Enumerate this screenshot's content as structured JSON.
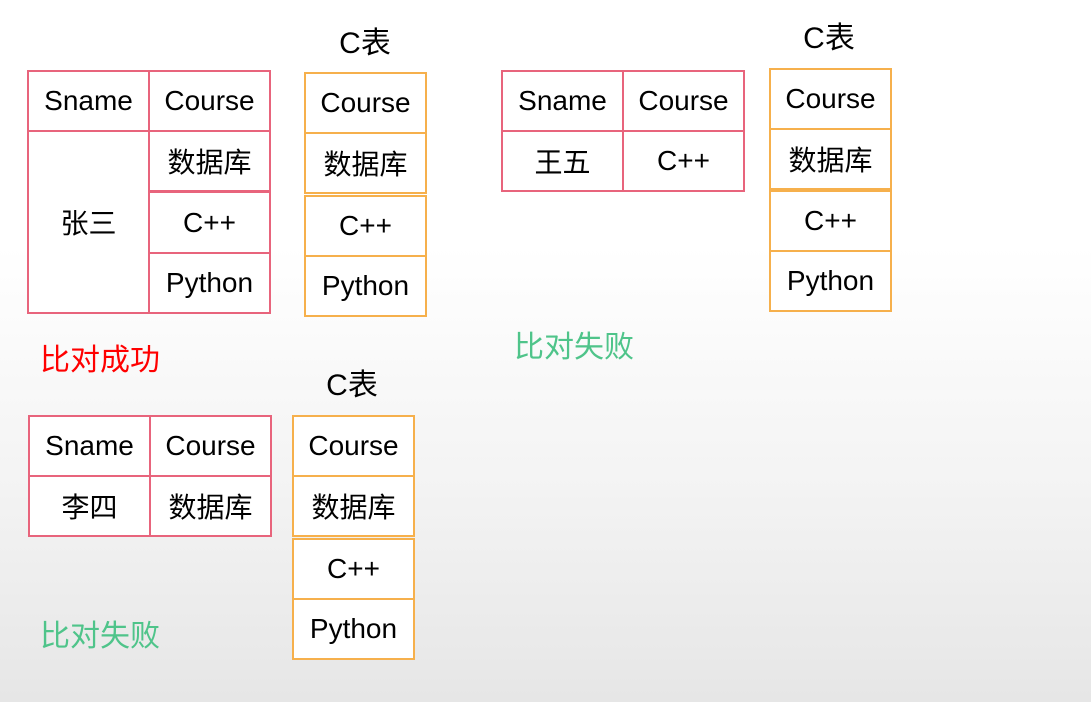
{
  "colors": {
    "student_table_border": "#e8647c",
    "c_table_border": "#f6b04c",
    "success_text": "#ff0000",
    "failure_text": "#4fc48a"
  },
  "groups": [
    {
      "student_table": {
        "headers": [
          "Sname",
          "Course"
        ],
        "name": "张三",
        "courses": [
          "数据库",
          "C++",
          "Python"
        ]
      },
      "c_table": {
        "title": "C表",
        "header": "Course",
        "rows": [
          "数据库",
          "C++",
          "Python"
        ]
      },
      "result": "比对成功"
    },
    {
      "student_table": {
        "headers": [
          "Sname",
          "Course"
        ],
        "name": "王五",
        "courses": [
          "C++"
        ]
      },
      "c_table": {
        "title": "C表",
        "header": "Course",
        "rows": [
          "数据库",
          "C++",
          "Python"
        ]
      },
      "result": "比对失败"
    },
    {
      "student_table": {
        "headers": [
          "Sname",
          "Course"
        ],
        "name": "李四",
        "courses": [
          "数据库"
        ]
      },
      "c_table": {
        "title": "C表",
        "header": "Course",
        "rows": [
          "数据库",
          "C++",
          "Python"
        ]
      },
      "result": "比对失败"
    }
  ]
}
